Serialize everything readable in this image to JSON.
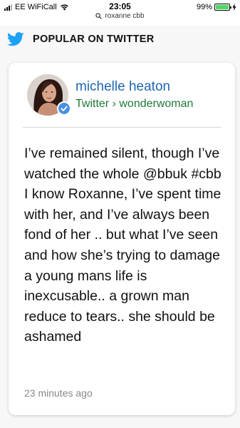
{
  "status_bar": {
    "carrier": "EE WiFiCall",
    "time": "23:05",
    "url": "roxanne cbb",
    "battery_percent": "99%",
    "battery_level": 0.99,
    "battery_color": "#4cd964"
  },
  "section": {
    "title": "POPULAR ON TWITTER",
    "icon": "twitter-bird-icon",
    "accent": "#1da1f2"
  },
  "tweet": {
    "author_name": "michelle heaton",
    "source": "Twitter",
    "separator": "›",
    "handle": "wonderwoman",
    "verified": true,
    "text": "I’ve remained silent, though I’ve watched the whole @bbuk #cbb I know Roxanne, I’ve spent time with her, and I’ve always been fond of her .. but what I’ve seen and how she’s trying to damage a young mans life is inexcusable.. a grown man reduce to tears.. she should be ashamed",
    "timestamp": "23 minutes ago",
    "name_color": "#1e66b4",
    "source_color": "#1f7a3a"
  }
}
